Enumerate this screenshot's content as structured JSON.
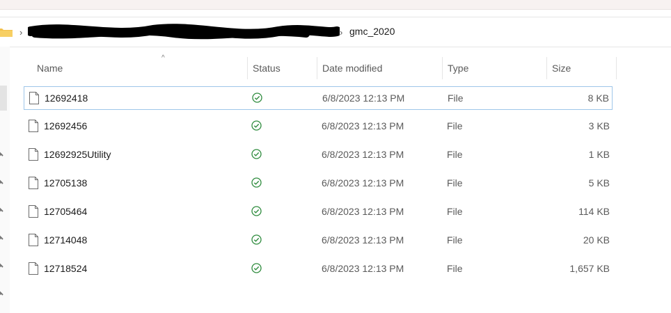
{
  "breadcrumb": {
    "current": "gmc_2020"
  },
  "columns": {
    "name": "Name",
    "status": "Status",
    "date": "Date modified",
    "type": "Type",
    "size": "Size"
  },
  "files": [
    {
      "name": "12692418",
      "date": "6/8/2023 12:13 PM",
      "type": "File",
      "size": "8 KB"
    },
    {
      "name": "12692456",
      "date": "6/8/2023 12:13 PM",
      "type": "File",
      "size": "3 KB"
    },
    {
      "name": "12692925Utility",
      "date": "6/8/2023 12:13 PM",
      "type": "File",
      "size": "1 KB"
    },
    {
      "name": "12705138",
      "date": "6/8/2023 12:13 PM",
      "type": "File",
      "size": "5 KB"
    },
    {
      "name": "12705464",
      "date": "6/8/2023 12:13 PM",
      "type": "File",
      "size": "114 KB"
    },
    {
      "name": "12714048",
      "date": "6/8/2023 12:13 PM",
      "type": "File",
      "size": "20 KB"
    },
    {
      "name": "12718524",
      "date": "6/8/2023 12:13 PM",
      "type": "File",
      "size": "1,657 KB"
    }
  ],
  "icons": {
    "folder": "folder-icon",
    "file": "file-icon",
    "status": "synced-check-icon"
  },
  "colors": {
    "accent": "#9ec6e9",
    "status_ok": "#2e8b3d",
    "folder": "#f3c04a"
  }
}
